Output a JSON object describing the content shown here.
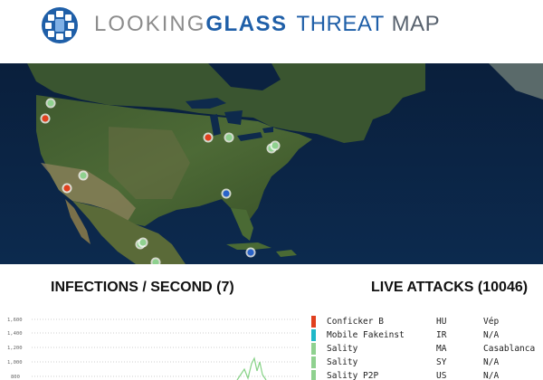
{
  "brand": {
    "logo_icon": "globe-mesh-icon",
    "part1": "LOOKING",
    "part2": "GLASS",
    "part3": "THREAT",
    "part4": "MAP"
  },
  "colors": {
    "brand_blue": "#1f5fa8",
    "brand_gray": "#8c8c8c",
    "red_dot": "#e0401f",
    "green_dot": "#8fd18f",
    "blue_dot": "#2a63c9",
    "cyan_bar": "#1fb8c8"
  },
  "infections": {
    "title": "INFECTIONS / SECOND (7)",
    "y_ticks": [
      "1,600",
      "1,400",
      "1,200",
      "1,000",
      "800"
    ]
  },
  "live": {
    "title": "LIVE ATTACKS (10046)",
    "rows": [
      {
        "name": "Conficker B",
        "cc": "HU",
        "city": "Vép",
        "color": "#e0401f"
      },
      {
        "name": "Mobile Fakeinst",
        "cc": "IR",
        "city": "N/A",
        "color": "#1fb8c8"
      },
      {
        "name": "Sality",
        "cc": "MA",
        "city": "Casablanca",
        "color": "#8fd18f"
      },
      {
        "name": "Sality",
        "cc": "SY",
        "city": "N/A",
        "color": "#8fd18f"
      },
      {
        "name": "Sality P2P",
        "cc": "US",
        "city": "N/A",
        "color": "#8fd18f"
      }
    ]
  },
  "map": {
    "markers": [
      {
        "type": "green",
        "icon": "infection-marker-icon"
      },
      {
        "type": "red",
        "icon": "infection-marker-icon"
      },
      {
        "type": "green",
        "icon": "infection-marker-icon"
      },
      {
        "type": "red",
        "icon": "infection-marker-icon"
      },
      {
        "type": "red",
        "icon": "infection-marker-icon"
      },
      {
        "type": "green",
        "icon": "infection-marker-icon"
      },
      {
        "type": "green",
        "icon": "infection-marker-icon"
      },
      {
        "type": "green",
        "icon": "infection-marker-icon"
      },
      {
        "type": "blue",
        "icon": "infection-marker-icon"
      },
      {
        "type": "green",
        "icon": "infection-marker-icon"
      },
      {
        "type": "green",
        "icon": "infection-marker-icon"
      },
      {
        "type": "blue",
        "icon": "infection-marker-icon"
      },
      {
        "type": "green",
        "icon": "infection-marker-icon"
      }
    ]
  }
}
